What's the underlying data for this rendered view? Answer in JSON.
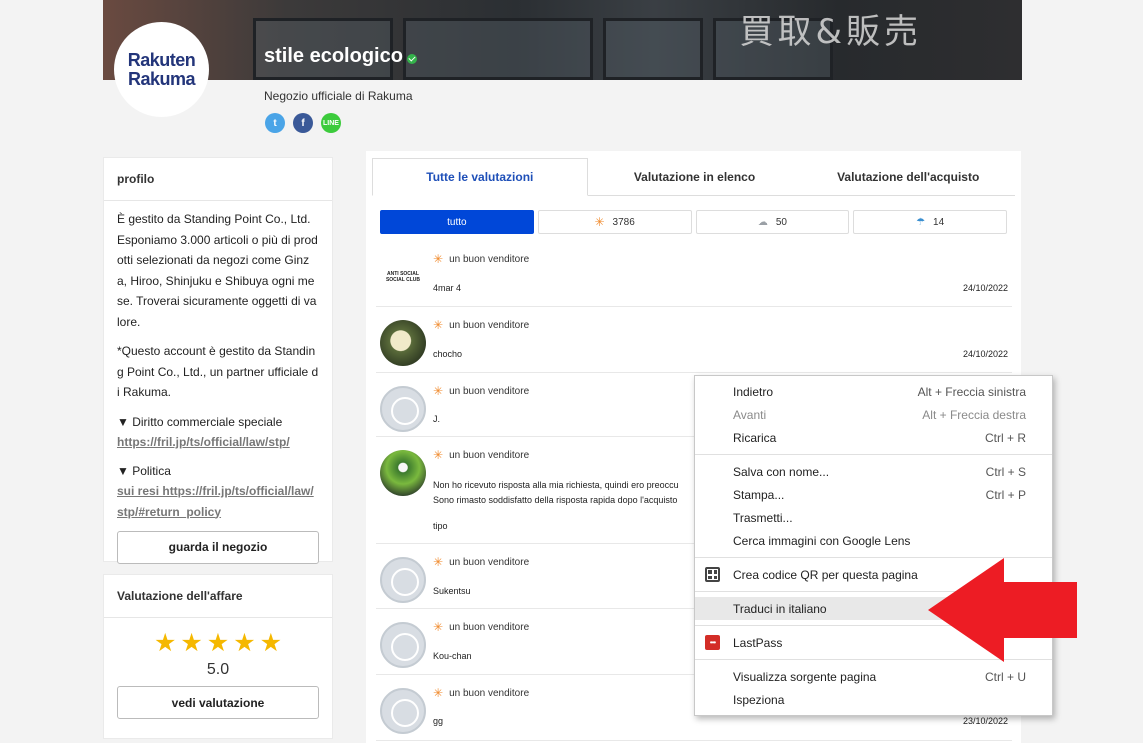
{
  "header": {
    "logo_line1": "Rakuten",
    "logo_line2": "Rakuma",
    "banner_sign": "買取&販売",
    "shop_name": "stile ecologico",
    "shop_subtitle": "Negozio ufficiale di Rakuma",
    "social": [
      {
        "icon": "twitter-icon",
        "glyph": "t"
      },
      {
        "icon": "facebook-icon",
        "glyph": "f"
      },
      {
        "icon": "line-icon",
        "glyph": "LINE"
      }
    ]
  },
  "profile": {
    "title": "profilo",
    "para1": "È gestito da Standing Point Co., Ltd. Esponiamo 3.000 articoli o più di prodotti selezionati da negozi come Ginza, Hiroo, Shinjuku e Shibuya ogni mese. Troverai sicuramente oggetti di valore.",
    "para2": "*Questo account è gestito da Standing Point Co., Ltd., un partner ufficiale di Rakuma.",
    "law_heading": "▼ Diritto commerciale speciale",
    "law_link": "https://fril.jp/ts/official/law/stp/",
    "policy_heading": "▼ Politica",
    "policy_link": "sui resi https://fril.jp/ts/official/law/stp/#return_policy",
    "shop_button": "guarda il negozio"
  },
  "rating": {
    "title": "Valutazione dell'affare",
    "stars": 5,
    "score": "5.0",
    "button": "vedi valutazione"
  },
  "tabs": [
    {
      "label": "Tutte le valutazioni",
      "active": true
    },
    {
      "label": "Valutazione in elenco",
      "active": false
    },
    {
      "label": "Valutazione dell'acquisto",
      "active": false
    }
  ],
  "filters": {
    "all": "tutto",
    "good": "3786",
    "neutral": "50",
    "bad": "14"
  },
  "reviews": [
    {
      "badge": "un buon venditore",
      "name": "4mar 4",
      "date": "24/10/2022",
      "avatar": "brand"
    },
    {
      "badge": "un buon venditore",
      "name": "chocho",
      "date": "24/10/2022",
      "avatar": "photo1"
    },
    {
      "badge": "un buon venditore",
      "name": "J.",
      "date": "",
      "avatar": "default"
    },
    {
      "badge": "un buon venditore",
      "line1": "Non ho ricevuto risposta alla mia richiesta, quindi ero preoccu",
      "line2": "Sono rimasto soddisfatto della risposta rapida dopo l'acquisto",
      "name": "tipo",
      "date": "",
      "avatar": "photo2"
    },
    {
      "badge": "un buon venditore",
      "name": "Sukentsu",
      "date": "",
      "avatar": "default"
    },
    {
      "badge": "un buon venditore",
      "name": "Kou-chan",
      "date": "",
      "avatar": "default"
    },
    {
      "badge": "un buon venditore",
      "name": "gg",
      "date": "23/10/2022",
      "avatar": "default"
    }
  ],
  "brand_avatar_text": "ANTI SOCIAL SOCIAL CLUB",
  "context_menu": {
    "back": {
      "label": "Indietro",
      "shortcut": "Alt + Freccia sinistra"
    },
    "forward": {
      "label": "Avanti",
      "shortcut": "Alt + Freccia destra"
    },
    "reload": {
      "label": "Ricarica",
      "shortcut": "Ctrl + R"
    },
    "save_as": {
      "label": "Salva con nome...",
      "shortcut": "Ctrl + S"
    },
    "print": {
      "label": "Stampa...",
      "shortcut": "Ctrl + P"
    },
    "cast": {
      "label": "Trasmetti..."
    },
    "lens": {
      "label": "Cerca immagini con Google Lens"
    },
    "qr": {
      "label": "Crea codice QR per questa pagina"
    },
    "translate": {
      "label": "Traduci in italiano"
    },
    "lastpass": {
      "label": "LastPass",
      "glyph": "•••"
    },
    "view_source": {
      "label": "Visualizza sorgente pagina",
      "shortcut": "Ctrl + U"
    },
    "inspect": {
      "label": "Ispeziona"
    }
  },
  "colors": {
    "accent": "#0047d8",
    "tab_active": "#1e4fb8",
    "star": "#f5b800",
    "arrow": "#ed1c24"
  }
}
